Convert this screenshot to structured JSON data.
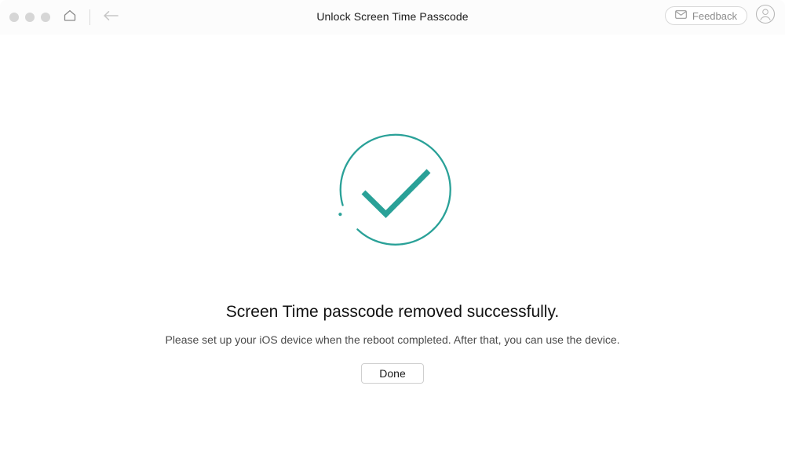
{
  "window": {
    "traffic_lights": [
      "close",
      "minimize",
      "maximize"
    ]
  },
  "titlebar": {
    "home_icon": "home-icon",
    "back_icon": "back-arrow-icon",
    "title": "Unlock Screen Time Passcode",
    "feedback": {
      "label": "Feedback",
      "icon": "envelope-icon"
    },
    "account": {
      "icon": "user-account-icon"
    }
  },
  "main": {
    "status_icon": "success-check-circle-icon",
    "headline": "Screen Time passcode removed successfully.",
    "subtitle": "Please set up your iOS device when the reboot completed. After that, you can use the device.",
    "done_button": "Done"
  },
  "colors": {
    "accent": "#2aa198",
    "titlebar_bg": "#fcfcfc",
    "body_bg": "#ffffff",
    "traffic_light": "#d6d6d6",
    "muted_text": "#8c8c8c",
    "border": "#d8d8d8"
  }
}
